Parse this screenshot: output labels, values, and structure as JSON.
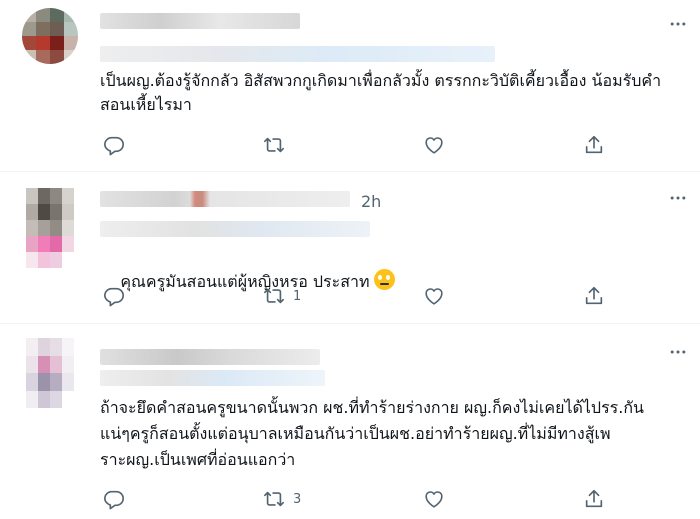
{
  "tweets": [
    {
      "time": "",
      "text": "เป็นผญ.ต้องรู้จักกลัว อิสัสพวกกูเกิดมาเพื่อกลัวมั้ง ตรรกกะวิบัติเคี้ยวเอื้อง น้อมรับคำสอนเหี้ยไรมา",
      "actions": {
        "reply": "",
        "retweet": "",
        "like": "",
        "share": ""
      }
    },
    {
      "time": "2h",
      "text": "คุณครูมันสอนแต่ผู้หญิงหรอ ประสาท",
      "emoji": "rolling-eyes-emoji",
      "actions": {
        "reply": "",
        "retweet": "1",
        "like": "",
        "share": ""
      }
    },
    {
      "time": "",
      "text": "ถ้าจะยึดคำสอนครูขนาดนั้นพวก ผช.ที่ทำร้ายร่างกาย ผญ.ก็คงไม่เคยได้ไปรร.กันแน่ๆครูก็สอนตั้งแต่อนุบาลเหมือนกันว่าเป็นผช.อย่าทำร้ายผญ.ที่ไม่มีทางสู้เพราะผญ.เป็นเพศที่อ่อนแอกว่า",
      "actions": {
        "reply": "",
        "retweet": "3",
        "like": "",
        "share": ""
      }
    }
  ],
  "icons": {
    "reply": "reply-icon",
    "retweet": "retweet-icon",
    "like": "like-icon",
    "share": "share-icon",
    "more": "more-options-icon"
  },
  "colors": {
    "text": "#0f1419",
    "secondary": "#536471",
    "divider": "#eff3f4"
  }
}
